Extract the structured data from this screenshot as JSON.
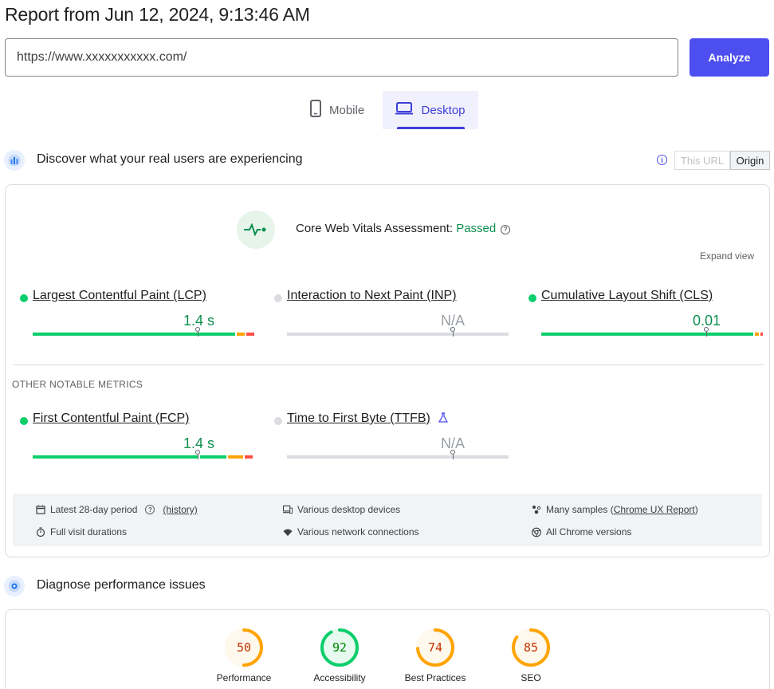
{
  "report_title": "Report from Jun 12, 2024, 9:13:46 AM",
  "url_input": {
    "value": "https://www.xxxxxxxxxxx.com/"
  },
  "analyze_label": "Analyze",
  "tabs": {
    "mobile": "Mobile",
    "desktop": "Desktop",
    "selected": "Desktop"
  },
  "field_section": {
    "title": "Discover what your real users are experiencing",
    "toggle_this_url": "This URL",
    "toggle_origin": "Origin",
    "info": "i"
  },
  "cwv": {
    "label": "Core Web Vitals Assessment: ",
    "status": "Passed",
    "help": "?",
    "expand": "Expand view"
  },
  "colors": {
    "good": "#0cce6b",
    "needs_improvement": "#ffa400",
    "poor": "#ff4e42",
    "na": "#dadce0",
    "accent": "#4d4eef"
  },
  "metrics": [
    {
      "name": "Largest Contentful Paint (LCP)",
      "value": "1.4 s",
      "status": "good",
      "distribution": [
        92,
        4,
        4
      ],
      "p75": 0.75
    },
    {
      "name": "Interaction to Next Paint (INP)",
      "value": "N/A",
      "status": "na",
      "distribution": [],
      "p75": 0.75
    },
    {
      "name": "Cumulative Layout Shift (CLS)",
      "value": "0.01",
      "status": "good",
      "distribution": [
        97,
        2,
        1
      ],
      "p75": 0.75
    }
  ],
  "other_notable": "OTHER NOTABLE METRICS",
  "other_metrics": [
    {
      "name": "First Contentful Paint (FCP)",
      "value": "1.4 s",
      "status": "good",
      "distribution": [
        88,
        8,
        4
      ],
      "p75": 0.75
    },
    {
      "name": "Time to First Byte (TTFB)",
      "value": "N/A",
      "status": "na",
      "distribution": [],
      "p75": 0.75,
      "experimental": true
    }
  ],
  "footer": {
    "period": "Latest 28-day period",
    "history": "(history)",
    "devices": "Various desktop devices",
    "samples_prefix": "Many samples (",
    "samples_link": "Chrome UX Report",
    "samples_suffix": ")",
    "durations": "Full visit durations",
    "network": "Various network connections",
    "versions": "All Chrome versions"
  },
  "lab_section": {
    "title": "Diagnose performance issues"
  },
  "scores": [
    {
      "label": "Performance",
      "score": 50,
      "color": "#ffa400",
      "text_color": "#c33300",
      "bg": "#fff8ec"
    },
    {
      "label": "Accessibility",
      "score": 92,
      "color": "#0cce6b",
      "text_color": "#008800",
      "bg": "#e6faef"
    },
    {
      "label": "Best Practices",
      "score": 74,
      "color": "#ffa400",
      "text_color": "#c33300",
      "bg": "#fff8ec"
    },
    {
      "label": "SEO",
      "score": 85,
      "color": "#ffa400",
      "text_color": "#c33300",
      "bg": "#fff8ec"
    }
  ]
}
